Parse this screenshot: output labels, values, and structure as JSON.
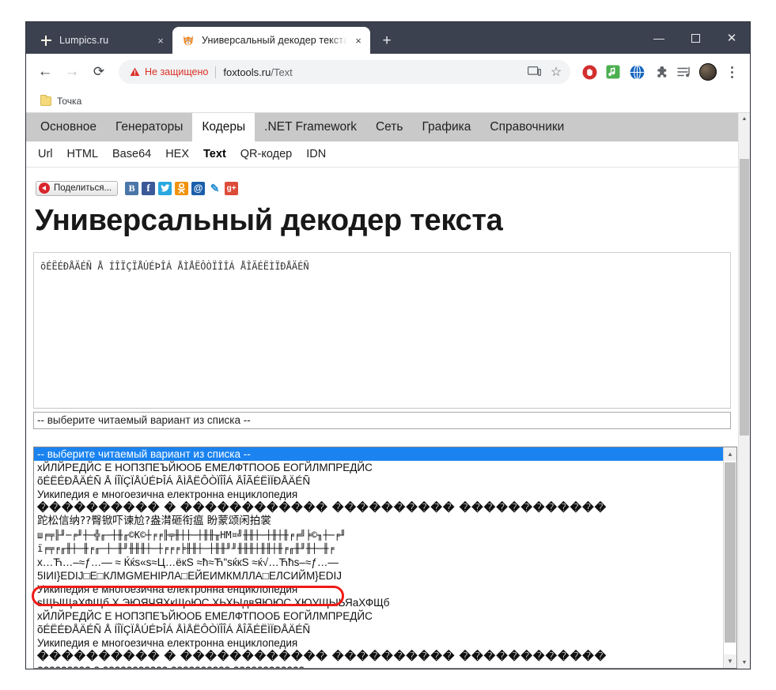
{
  "browser": {
    "tabs": [
      {
        "title": "Lumpics.ru",
        "favicon": "orange-slice-icon",
        "active": false,
        "close_label": "×"
      },
      {
        "title": "Универсальный декодер текста",
        "favicon": "fox-icon",
        "active": true,
        "close_label": "×"
      }
    ],
    "new_tab_label": "+",
    "window_controls": {
      "minimize": "—",
      "maximize": "□",
      "close": "✕"
    },
    "toolbar": {
      "back_label": "←",
      "forward_label": "→",
      "reload_label": "⟳",
      "security_text": "Не защищено",
      "url_host": "foxtools.ru",
      "url_path": "/Text",
      "cast_icon": "cast-icon",
      "bookmark_star": "☆",
      "extensions": [
        {
          "name": "adblock-icon",
          "color": "#d93025"
        },
        {
          "name": "music-icon",
          "color": "#4caf50"
        },
        {
          "name": "globe-icon",
          "color": "#1565c0"
        },
        {
          "name": "puzzle-icon",
          "color": "#5f6368"
        },
        {
          "name": "playlist-icon",
          "color": "#5f6368"
        }
      ]
    },
    "bookmarks": [
      {
        "label": "Точка",
        "icon": "folder-icon"
      }
    ]
  },
  "site": {
    "nav": [
      {
        "label": "Основное",
        "active": false
      },
      {
        "label": "Генераторы",
        "active": false
      },
      {
        "label": "Кодеры",
        "active": true
      },
      {
        "label": ".NET Framework",
        "active": false
      },
      {
        "label": "Сеть",
        "active": false
      },
      {
        "label": "Графика",
        "active": false
      },
      {
        "label": "Справочники",
        "active": false
      }
    ],
    "subnav": [
      {
        "label": "Url",
        "active": false
      },
      {
        "label": "HTML",
        "active": false
      },
      {
        "label": "Base64",
        "active": false
      },
      {
        "label": "HEX",
        "active": false
      },
      {
        "label": "Text",
        "active": true
      },
      {
        "label": "QR-кодер",
        "active": false
      },
      {
        "label": "IDN",
        "active": false
      }
    ],
    "share": {
      "button_label": "Поделиться...",
      "networks": [
        {
          "name": "vk-share-icon",
          "glyph": "В"
        },
        {
          "name": "facebook-share-icon",
          "glyph": "f"
        },
        {
          "name": "twitter-share-icon",
          "glyph": "ᵥ"
        },
        {
          "name": "odnoklassniki-share-icon",
          "glyph": "ок"
        },
        {
          "name": "mailru-share-icon",
          "glyph": "@"
        },
        {
          "name": "livejournal-share-icon",
          "glyph": "✎"
        },
        {
          "name": "googleplus-share-icon",
          "glyph": "g+"
        }
      ]
    },
    "title": "Универсальный декодер текста",
    "textarea": {
      "value": "õÉËÉÐÅÄÉÑ Å ÍÎÏÇÏÅÚÉÞÎÁ ÅÌÅËÔÒÏÎÎÁ ÅÎÃÉËÌÏÐÅÄÉÑ",
      "placeholder": ""
    },
    "select": {
      "value": "-- выберите читаемый вариант из списка --",
      "options": [
        {
          "text": "-- выберите читаемый вариант из списка --",
          "selected": true,
          "style": "normal"
        },
        {
          "text": "хЙЛЙРЕДЙС Е НОПЗПЕЪЙЮОБ ЕМЕЛФТПООБ ЕОГЙЛМПРЕДЙС",
          "selected": false,
          "style": "normal"
        },
        {
          "text": "õÉËÉÐÅÄÉÑ Å ÍÎÏÇÏÅÚÉÞÎÁ ÅÌÅËÔÒÏÎÎÁ ÅÎÃÉËÌÏÐÅÄÉÑ",
          "selected": false,
          "style": "normal"
        },
        {
          "text": "Уикипедия е многоезична електронна енциклопедия",
          "selected": false,
          "style": "normal",
          "highlighted": true
        },
        {
          "text": "���������� � ������������ ���������� ������������",
          "selected": false,
          "style": "dia"
        },
        {
          "text": "跎松信纳??臀锨吓谏尬?盎潸砸衔瘟 盼蒙颂闲拍裳",
          "selected": false,
          "style": "cjk"
        },
        {
          "text": "ш╒╤╟╜─╒╜┼─╬╓─┼╫╓©К©┼╒╒╟╤╫┼┼─┼╫╫╥НМ¤╝╫╫┼─┼╫┼╫╒╒╝╞©╖┼─╒╜",
          "selected": false,
          "style": "mono"
        },
        {
          "text": "ï╒╤╒╓╫┼─╫╒╓─┼─╫╜╫╫╫┼─┼╒╒╒╞╫╫┼─┼╫╫╜╜╫╫╫┼╫╫┼╫╒╓╫╜╫┼─╫╒",
          "selected": false,
          "style": "mono"
        },
        {
          "text": "x…Ћ…–≈ƒ…— ≈ Ќќs«s≈Ц…ёкS ≈ћ≈Ћ\"sќкS ≈ќ√…Ћћs–≈ƒ…—",
          "selected": false,
          "style": "normal"
        },
        {
          "text": "5ІИІ}EDIJ□E□КЛMGMEHIРЛА□ЕЙЕИМКМЛЛА□ЕЛСИЙМ}EDIJ",
          "selected": false,
          "style": "normal"
        },
        {
          "text": "Уикипедия е многоезична електронна енциклопедия",
          "selected": false,
          "style": "normal"
        },
        {
          "text": "sЩЫЩаХФЩб Х ЭЮЯЧЯХкЩоЮС ХЬХЫдвЯЮЮС ХЮУЩЫЬЯаХФЩб",
          "selected": false,
          "style": "normal"
        },
        {
          "text": "хЙЛЙРЕДЙС Е НОПЗПЕЪЙЮОБ ЕМЕЛФТПООБ ЕОГЙЛМПРЕДЙС",
          "selected": false,
          "style": "normal"
        },
        {
          "text": "õÉËÉÐÅÄÉÑ Å ÍÎÏÇÏÅÚÉÞÎÁ ÅÌÅËÔÒÏÎÎÁ ÅÎÃÉËÌÏÐÅÄÉÑ",
          "selected": false,
          "style": "normal"
        },
        {
          "text": "Уикипедия е многоезична електронна енциклопедия",
          "selected": false,
          "style": "normal"
        },
        {
          "text": "���������� � ������������ ���������� ������������",
          "selected": false,
          "style": "dia"
        },
        {
          "text": "????????? ? ??????????? ?????????? ????????????",
          "selected": false,
          "style": "normal"
        }
      ]
    }
  },
  "annotation": {
    "name": "red-highlight-box",
    "color": "#ef1b17"
  }
}
